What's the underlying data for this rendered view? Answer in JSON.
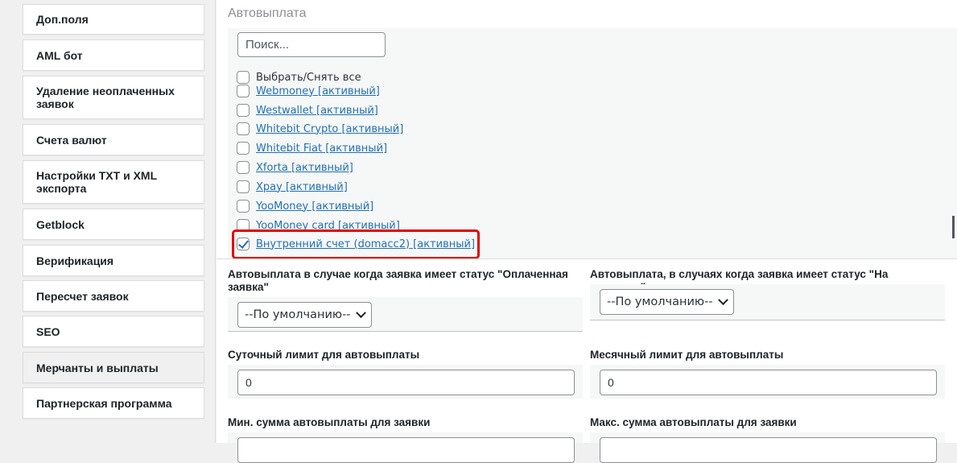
{
  "sidebar": {
    "items": [
      {
        "label": "Доп.поля"
      },
      {
        "label": "AML бот"
      },
      {
        "label": "Удаление неоплаченных заявок"
      },
      {
        "label": "Счета валют"
      },
      {
        "label": "Настройки TXT и XML экспорта"
      },
      {
        "label": "Getblock"
      },
      {
        "label": "Верификация"
      },
      {
        "label": "Пересчет заявок"
      },
      {
        "label": "SEO"
      },
      {
        "label": "Мерчанты и выплаты",
        "active": true
      },
      {
        "label": "Партнерская программа"
      }
    ]
  },
  "autopayout": {
    "title": "Автовыплата",
    "search_placeholder": "Поиск...",
    "select_all_label": "Выбрать/Снять все",
    "options": [
      {
        "label": "Webmoney [активный]",
        "checked": false
      },
      {
        "label": "Westwallet [активный]",
        "checked": false
      },
      {
        "label": "Whitebit Crypto [активный]",
        "checked": false
      },
      {
        "label": "Whitebit Fiat [активный]",
        "checked": false
      },
      {
        "label": "Xforta [активный]",
        "checked": false
      },
      {
        "label": "Xpay [активный]",
        "checked": false
      },
      {
        "label": "YooMoney [активный]",
        "checked": false
      },
      {
        "label": "YooMoney card [активный]",
        "checked": false
      },
      {
        "label": "Внутренний счет (domacc2) [активный]",
        "checked": true
      }
    ],
    "highlight_color": "#e00000"
  },
  "fields": {
    "paid_status_label": "Автовыплата в случае когда заявка имеет статус \"Оплаченная заявка\"",
    "paid_status_value": "--По умолчанию--",
    "review_status_label": "Автовыплата, в случаях когда заявка имеет статус \"На проверке\"",
    "review_status_value": "--По умолчанию--",
    "daily_limit_label": "Суточный лимит для автовыплаты",
    "daily_limit_value": "0",
    "monthly_limit_label": "Месячный лимит для автовыплаты",
    "monthly_limit_value": "0",
    "min_sum_label": "Мин. сумма автовыплаты для заявки",
    "max_sum_label": "Макс. сумма автовыплаты для заявки"
  },
  "colors": {
    "link": "#2271b1",
    "accent_highlight": "#e00000",
    "border": "#8c8f94"
  }
}
